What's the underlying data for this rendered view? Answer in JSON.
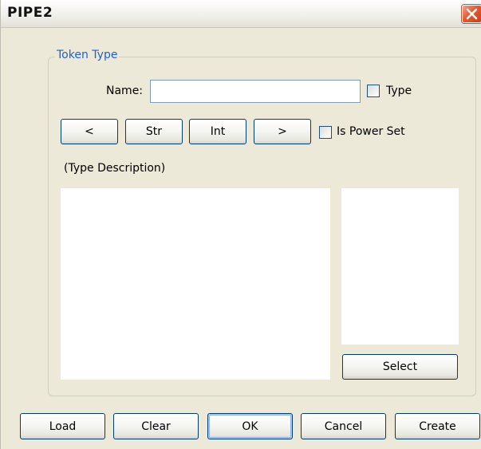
{
  "window": {
    "title": "PIPE2"
  },
  "group": {
    "legend": "Token Type",
    "name_label": "Name:",
    "name_value": "",
    "type_checkbox_label": "Type",
    "type_checked": false,
    "nav_prev_label": "<",
    "str_label": "Str",
    "int_label": "Int",
    "nav_next_label": ">",
    "power_set_label": "Is Power Set",
    "power_set_checked": false,
    "description_label": "(Type Description)",
    "select_label": "Select"
  },
  "footer": {
    "load_label": "Load",
    "clear_label": "Clear",
    "ok_label": "OK",
    "cancel_label": "Cancel",
    "create_label": "Create"
  },
  "colors": {
    "window_bg": "#ece9d8",
    "legend_text": "#1f5fd8",
    "close_button": "#e35a32",
    "button_border": "#003c74",
    "textbox_border": "#7f9db9"
  }
}
